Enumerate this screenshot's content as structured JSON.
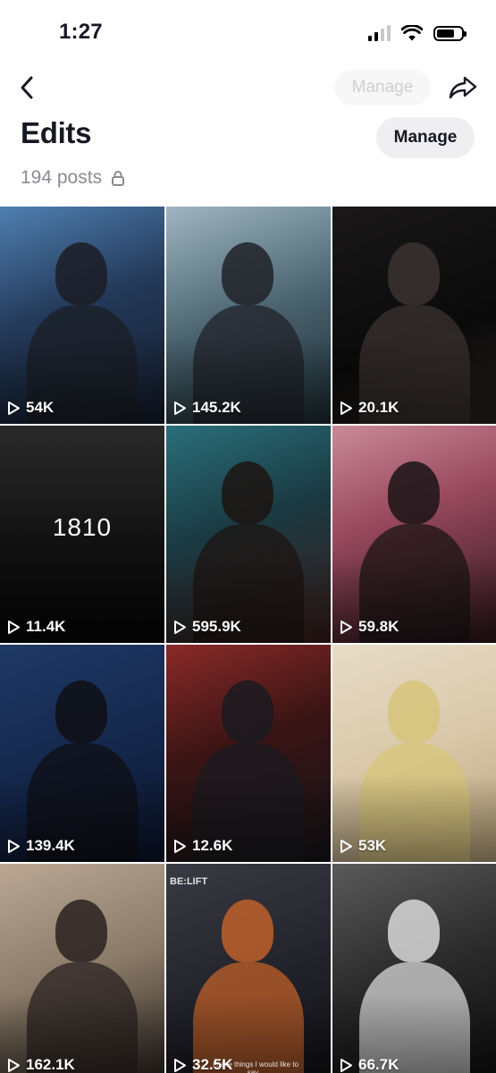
{
  "status_bar": {
    "time": "1:27",
    "icons": [
      "cellular-signal-icon",
      "wifi-icon",
      "battery-icon"
    ]
  },
  "nav": {
    "back_icon": "chevron-left-icon",
    "manage_faded_label": "Manage",
    "share_icon": "share-arrow-icon"
  },
  "header": {
    "title": "Edits",
    "manage_label": "Manage",
    "post_count": "194 posts",
    "lock_icon": "lock-icon"
  },
  "colors": {
    "text_primary": "#161823",
    "text_secondary": "#8a8b91",
    "button_bg": "#efeff1",
    "background": "#ffffff"
  },
  "grid": {
    "play_icon": "play-icon",
    "tiles": [
      {
        "views": "54K",
        "bg": "linear-gradient(160deg,#4f7fb0 0%,#243a5a 45%,#121a28 100%)",
        "figure": "#1b1d24"
      },
      {
        "views": "145.2K",
        "bg": "linear-gradient(160deg,#9fb6c2 0%,#4b6470 50%,#1b2a30 100%)",
        "figure": "#202228"
      },
      {
        "views": "20.1K",
        "bg": "linear-gradient(160deg,#1a1818 0%,#0a0a0a 60%,#2a2220 100%)",
        "figure": "#3a3330"
      },
      {
        "views": "11.4K",
        "bg": "linear-gradient(180deg,#2a2a2a 0%,#111111 55%,#050505 100%)",
        "caption": "1810"
      },
      {
        "views": "595.9K",
        "bg": "linear-gradient(160deg,#2a6f7a 0%,#1a3a42 45%,#3a1c1a 100%)",
        "figure": "#1c1412"
      },
      {
        "views": "59.8K",
        "bg": "linear-gradient(160deg,#c98a96 0%,#9a4a60 40%,#2a1418 100%)",
        "figure": "#1a1416"
      },
      {
        "views": "139.4K",
        "bg": "linear-gradient(160deg,#1f3a66 0%,#14264a 55%,#0a1226 100%)",
        "figure": "#0f0f14"
      },
      {
        "views": "12.6K",
        "bg": "linear-gradient(160deg,#8a2a28 0%,#3a1414 45%,#141418 100%)",
        "figure": "#1a1a20"
      },
      {
        "views": "53K",
        "bg": "linear-gradient(160deg,#e8dcc8 0%,#d8c8a8 50%,#b8a27a 100%)",
        "figure": "#d6c47a"
      },
      {
        "views": "162.1K",
        "bg": "linear-gradient(160deg,#b9a894 0%,#8a7a68 50%,#2a2420 100%)",
        "figure": "#2a2220"
      },
      {
        "views": "32.5K",
        "bg": "linear-gradient(160deg,#3a3a44 0%,#22222a 55%,#101014 100%)",
        "figure": "#c0602a",
        "corner_text": "BE:LIFT",
        "subtitle": "I have things I would like to say..."
      },
      {
        "views": "66.7K",
        "bg": "linear-gradient(160deg,#5a5a5a 0%,#2a2a2a 50%,#0e0e0e 100%)",
        "figure": "#d8d8d8"
      }
    ]
  }
}
